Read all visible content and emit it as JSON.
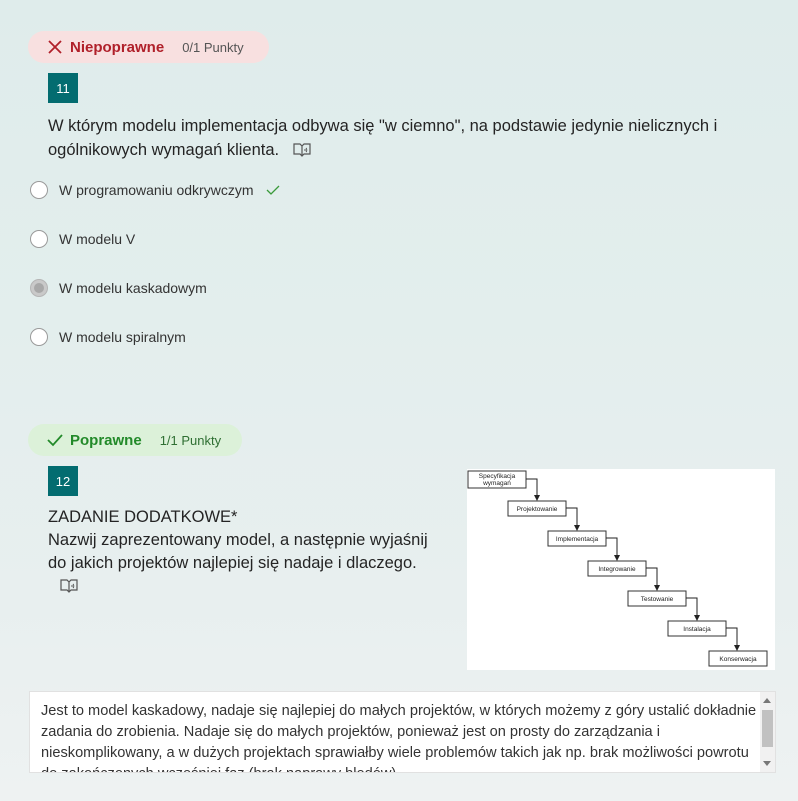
{
  "question11": {
    "result_label": "Niepoprawne",
    "points": "0/1 Punkty",
    "number": "11",
    "text": "W którym modelu implementacja odbywa się \"w ciemno\", na podstawie jedynie nielicznych i ogólnikowych wymagań klienta.",
    "options": [
      {
        "label": "W programowaniu odkrywczym",
        "correct": true,
        "selected": false
      },
      {
        "label": "W modelu V",
        "correct": false,
        "selected": false
      },
      {
        "label": "W modelu kaskadowym",
        "correct": false,
        "selected": true
      },
      {
        "label": "W modelu spiralnym",
        "correct": false,
        "selected": false
      }
    ]
  },
  "question12": {
    "result_label": "Poprawne",
    "points": "1/1 Punkty",
    "number": "12",
    "title": "ZADANIE DODATKOWE*",
    "text_line1": "Nazwij zaprezentowany model, a następnie wyjaśnij",
    "text_line2": "do jakich projektów najlepiej się nadaje i dlaczego.",
    "diagram_steps": [
      "Specyfikacja wymagań",
      "Projektowanie",
      "Implementacja",
      "Integrowanie",
      "Testowanie",
      "Instalacja",
      "Konserwacja"
    ],
    "answer": "Jest to model kaskadowy, nadaje się najlepiej do małych projektów, w których możemy z góry ustalić dokładnie zadania do zrobienia. Nadaje się do małych projektów, ponieważ jest on prosty do zarządzania i nieskomplikowany, a w dużych projektach sprawiałby wiele problemów takich jak np. brak możliwości powrotu do zakończonych wcześniej faz (brak naprawy błędów)"
  },
  "colors": {
    "incorrect": "#b0202a",
    "correct": "#238a2a",
    "badge": "#036c70"
  },
  "icons": {
    "incorrect": "x-icon",
    "correct": "check-icon",
    "reader": "immersive-reader-icon"
  }
}
